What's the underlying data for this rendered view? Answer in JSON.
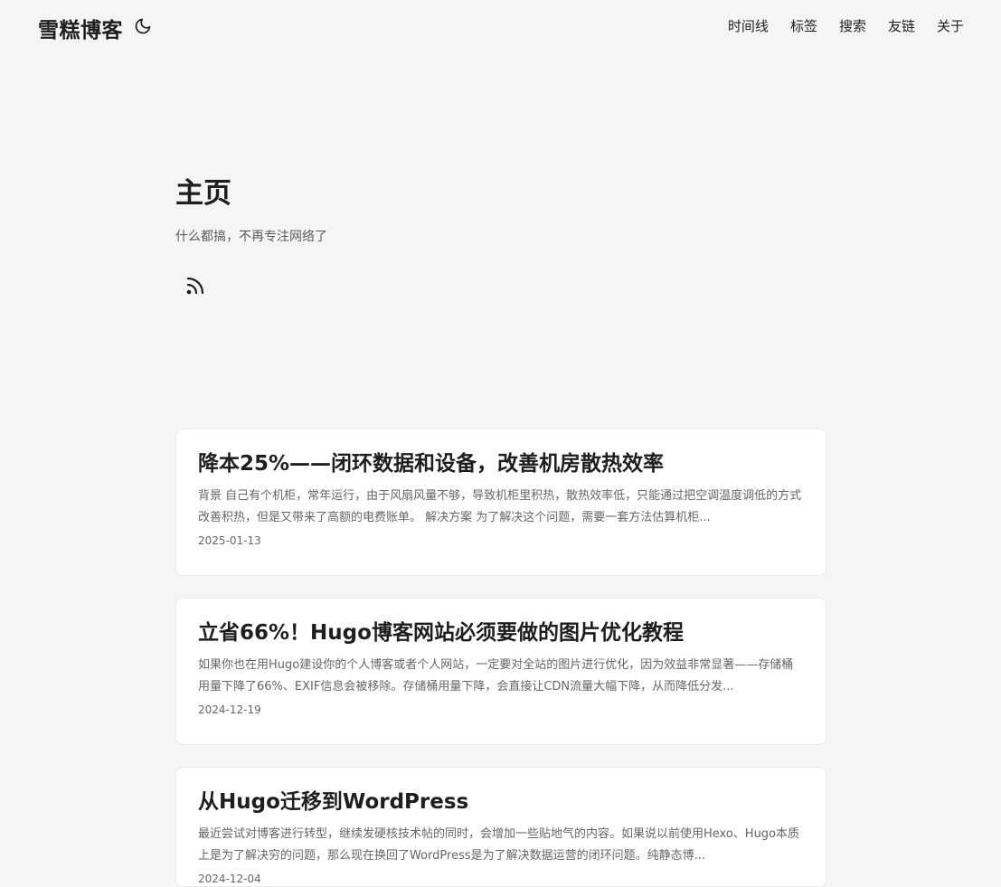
{
  "header": {
    "logo": "雪糕博客",
    "theme_icon": "moon-icon",
    "nav": [
      "时间线",
      "标签",
      "搜索",
      "友链",
      "关于"
    ]
  },
  "hero": {
    "title": "主页",
    "subtitle": "什么都搞，不再专注网络了",
    "rss_icon": "rss-icon"
  },
  "posts": [
    {
      "title": "降本25%——闭环数据和设备，改善机房散热效率",
      "excerpt": "背景 自己有个机柜，常年运行，由于风扇风量不够，导致机柜里积热，散热效率低，只能通过把空调温度调低的方式改善积热，但是又带来了高额的电费账单。 解决方案 为了解决这个问题，需要一套方法估算机柜...",
      "date": "2025-01-13"
    },
    {
      "title": "立省66%！Hugo博客网站必须要做的图片优化教程",
      "excerpt": "如果你也在用Hugo建设你的个人博客或者个人网站，一定要对全站的图片进行优化，因为效益非常显著——存储桶用量下降了66%、EXIF信息会被移除。存储桶用量下降，会直接让CDN流量大幅下降，从而降低分发...",
      "date": "2024-12-19"
    },
    {
      "title": "从Hugo迁移到WordPress",
      "excerpt": "最近尝试对博客进行转型，继续发硬核技术帖的同时，会增加一些贴地气的内容。如果说以前使用Hexo、Hugo本质上是为了解决穷的问题，那么现在换回了WordPress是为了解决数据运营的闭环问题。纯静态博...",
      "date": "2024-12-04"
    }
  ]
}
